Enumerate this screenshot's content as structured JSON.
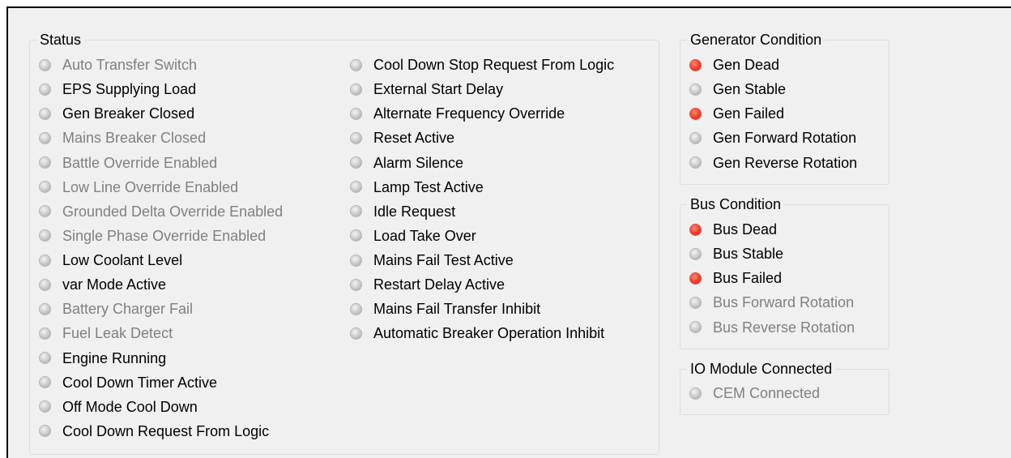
{
  "colors": {
    "led_on": "#f13a28",
    "led_off": "#c8c8c8",
    "text_enabled": "#000000",
    "text_disabled": "#808080"
  },
  "status": {
    "title": "Status",
    "col1": [
      {
        "label": "Auto Transfer Switch",
        "enabled": false,
        "lit": false
      },
      {
        "label": "EPS Supplying Load",
        "enabled": true,
        "lit": false
      },
      {
        "label": "Gen Breaker Closed",
        "enabled": true,
        "lit": false
      },
      {
        "label": "Mains Breaker Closed",
        "enabled": false,
        "lit": false
      },
      {
        "label": "Battle Override Enabled",
        "enabled": false,
        "lit": false
      },
      {
        "label": "Low Line Override Enabled",
        "enabled": false,
        "lit": false
      },
      {
        "label": "Grounded Delta Override Enabled",
        "enabled": false,
        "lit": false
      },
      {
        "label": "Single Phase Override Enabled",
        "enabled": false,
        "lit": false
      },
      {
        "label": "Low Coolant Level",
        "enabled": true,
        "lit": false
      },
      {
        "label": "var Mode Active",
        "enabled": true,
        "lit": false
      },
      {
        "label": "Battery Charger Fail",
        "enabled": false,
        "lit": false
      },
      {
        "label": "Fuel Leak Detect",
        "enabled": false,
        "lit": false
      },
      {
        "label": "Engine Running",
        "enabled": true,
        "lit": false
      },
      {
        "label": "Cool Down Timer Active",
        "enabled": true,
        "lit": false
      },
      {
        "label": "Off Mode Cool Down",
        "enabled": true,
        "lit": false
      },
      {
        "label": "Cool Down Request From Logic",
        "enabled": true,
        "lit": false
      }
    ],
    "col2": [
      {
        "label": "Cool Down Stop Request From Logic",
        "enabled": true,
        "lit": false
      },
      {
        "label": "External Start Delay",
        "enabled": true,
        "lit": false
      },
      {
        "label": "Alternate Frequency Override",
        "enabled": true,
        "lit": false
      },
      {
        "label": "Reset Active",
        "enabled": true,
        "lit": false
      },
      {
        "label": "Alarm Silence",
        "enabled": true,
        "lit": false
      },
      {
        "label": "Lamp Test Active",
        "enabled": true,
        "lit": false
      },
      {
        "label": "Idle Request",
        "enabled": true,
        "lit": false
      },
      {
        "label": "Load Take Over",
        "enabled": true,
        "lit": false
      },
      {
        "label": "Mains Fail Test Active",
        "enabled": true,
        "lit": false
      },
      {
        "label": "Restart Delay Active",
        "enabled": true,
        "lit": false
      },
      {
        "label": "Mains Fail Transfer Inhibit",
        "enabled": true,
        "lit": false
      },
      {
        "label": "Automatic Breaker Operation Inhibit",
        "enabled": true,
        "lit": false
      }
    ]
  },
  "generator": {
    "title": "Generator Condition",
    "items": [
      {
        "label": "Gen Dead",
        "enabled": true,
        "lit": true
      },
      {
        "label": "Gen Stable",
        "enabled": true,
        "lit": false
      },
      {
        "label": "Gen Failed",
        "enabled": true,
        "lit": true
      },
      {
        "label": "Gen Forward Rotation",
        "enabled": true,
        "lit": false
      },
      {
        "label": "Gen Reverse Rotation",
        "enabled": true,
        "lit": false
      }
    ]
  },
  "bus": {
    "title": "Bus Condition",
    "items": [
      {
        "label": "Bus Dead",
        "enabled": true,
        "lit": true
      },
      {
        "label": "Bus Stable",
        "enabled": true,
        "lit": false
      },
      {
        "label": "Bus Failed",
        "enabled": true,
        "lit": true
      },
      {
        "label": "Bus Forward Rotation",
        "enabled": false,
        "lit": false
      },
      {
        "label": "Bus Reverse Rotation",
        "enabled": false,
        "lit": false
      }
    ]
  },
  "io": {
    "title": "IO Module Connected",
    "items": [
      {
        "label": "CEM Connected",
        "enabled": false,
        "lit": false
      }
    ]
  }
}
